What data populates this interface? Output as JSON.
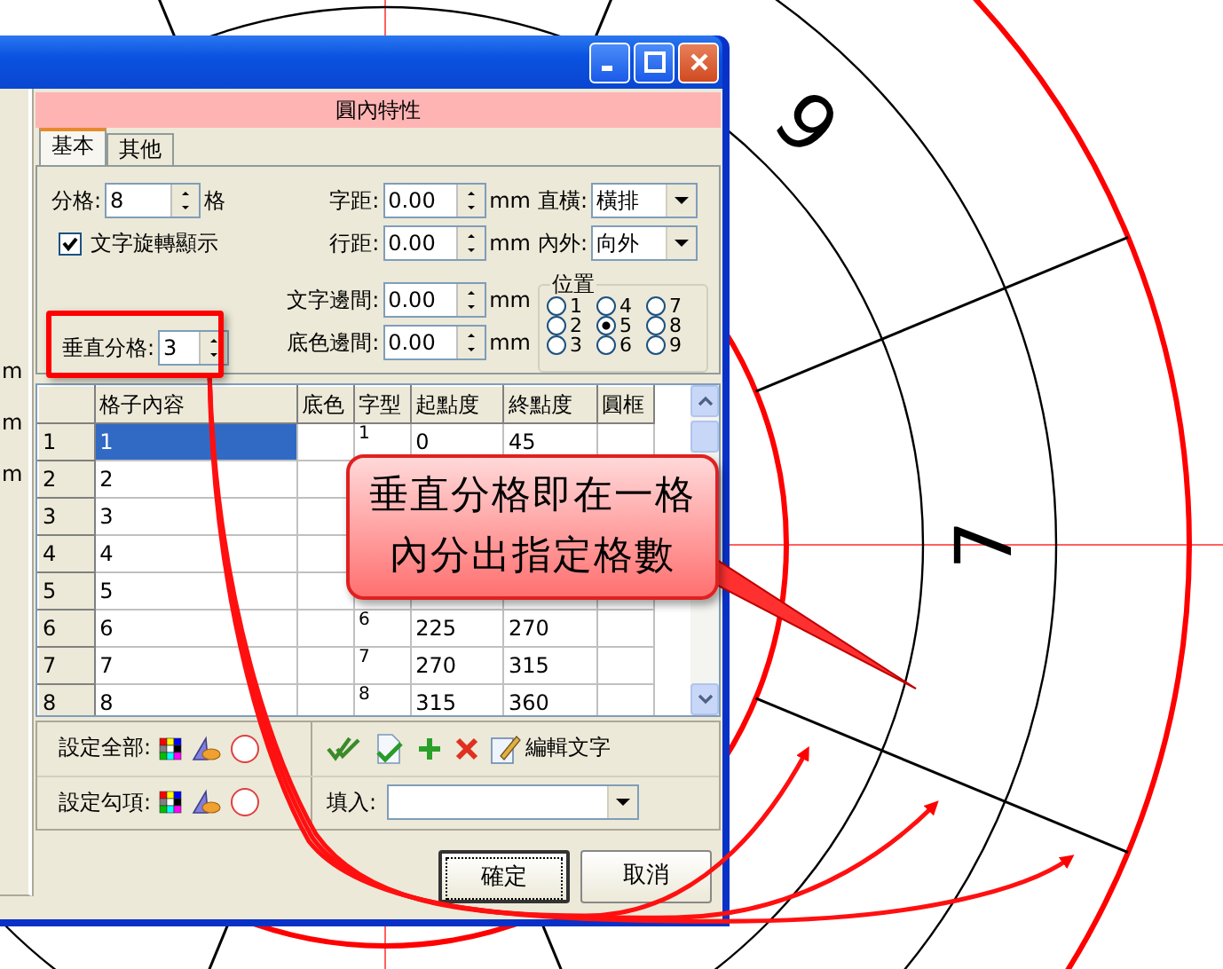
{
  "drawing": {
    "labels": [
      "6",
      "7"
    ]
  },
  "left_panel": {
    "texts": [
      "m",
      "m",
      "m"
    ]
  },
  "panel": {
    "title": "圓內特性"
  },
  "tabs": [
    {
      "label": "基本",
      "selected": true
    },
    {
      "label": "其他",
      "selected": false
    }
  ],
  "basic": {
    "divisions": {
      "label": "分格:",
      "value": "8",
      "unit": "格"
    },
    "rotate_text": {
      "label": "文字旋轉顯示",
      "checked": true
    },
    "vertical_divisions": {
      "label": "垂直分格:",
      "value": "3"
    },
    "spacing": [
      {
        "label": "字距:",
        "value": "0.00",
        "unit": "mm"
      },
      {
        "label": "行距:",
        "value": "0.00",
        "unit": "mm"
      },
      {
        "label": "文字邊間:",
        "value": "0.00",
        "unit": "mm"
      },
      {
        "label": "底色邊間:",
        "value": "0.00",
        "unit": "mm"
      }
    ],
    "selects": [
      {
        "label": "直橫:",
        "value": "橫排"
      },
      {
        "label": "內外:",
        "value": "向外"
      }
    ],
    "position": {
      "label": "位置",
      "options": [
        {
          "label": "1",
          "selected": false
        },
        {
          "label": "2",
          "selected": false
        },
        {
          "label": "3",
          "selected": false
        },
        {
          "label": "4",
          "selected": false
        },
        {
          "label": "5",
          "selected": true
        },
        {
          "label": "6",
          "selected": false
        },
        {
          "label": "7",
          "selected": false
        },
        {
          "label": "8",
          "selected": false
        },
        {
          "label": "9",
          "selected": false
        }
      ]
    }
  },
  "grid": {
    "columns": [
      "格子內容",
      "底色",
      "字型",
      "起點度",
      "終點度",
      "圓框"
    ],
    "rows": [
      {
        "number": "1",
        "content": "1",
        "font": "1",
        "start": "0",
        "end": "45",
        "selected": true
      },
      {
        "number": "2",
        "content": "2",
        "selected": false
      },
      {
        "number": "3",
        "content": "3",
        "selected": false
      },
      {
        "number": "4",
        "content": "4",
        "selected": false
      },
      {
        "number": "5",
        "content": "5",
        "selected": false
      },
      {
        "number": "6",
        "content": "6",
        "font": "6",
        "start": "225",
        "end": "270",
        "selected": false
      },
      {
        "number": "7",
        "content": "7",
        "font": "7",
        "start": "270",
        "end": "315",
        "selected": false
      },
      {
        "number": "8",
        "content": "8",
        "font": "8",
        "start": "315",
        "end": "360",
        "selected": false
      }
    ]
  },
  "toolbar": {
    "set_all_label": "設定全部:",
    "set_checked_label": "設定勾項:",
    "edit_text_button": "編輯文字",
    "fill_label": "填入:"
  },
  "buttons": [
    {
      "label": "確定",
      "default": true
    },
    {
      "label": "取消",
      "default": false
    }
  ],
  "annotation": {
    "lines": [
      "垂直分格即在一格",
      "內分出指定格數"
    ]
  }
}
